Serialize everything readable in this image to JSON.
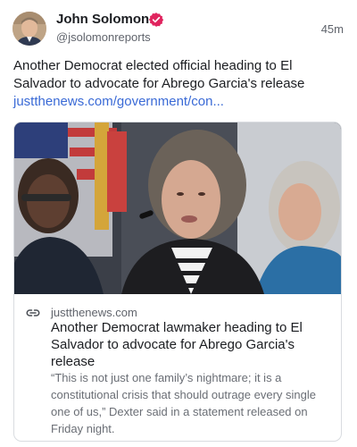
{
  "post": {
    "author": {
      "display_name": "John Solomon",
      "handle": "@jsolomonreports",
      "avatar_icon": "profile-photo",
      "verified_badge_icon": "verified-check-icon",
      "verified_color": "#e0245e"
    },
    "timestamp": "45m",
    "text": "Another Democrat elected official heading to El Salvador to advocate for Abrego Garcia's release",
    "link_text": "justthenews.com/government/con...",
    "link_color": "#3a6ad6"
  },
  "link_card": {
    "image_alt": "photo of three women at a press conference, woman in center speaking",
    "link_icon": "chain-link-icon",
    "domain": "justthenews.com",
    "title": "Another Democrat lawmaker heading to El Salvador to advocate for Abrego Garcia's release",
    "description": "“This is not just one family’s nightmare; it is a constitutional crisis that should outrage every single one of us,” Dexter said in a statement released on Friday night."
  }
}
